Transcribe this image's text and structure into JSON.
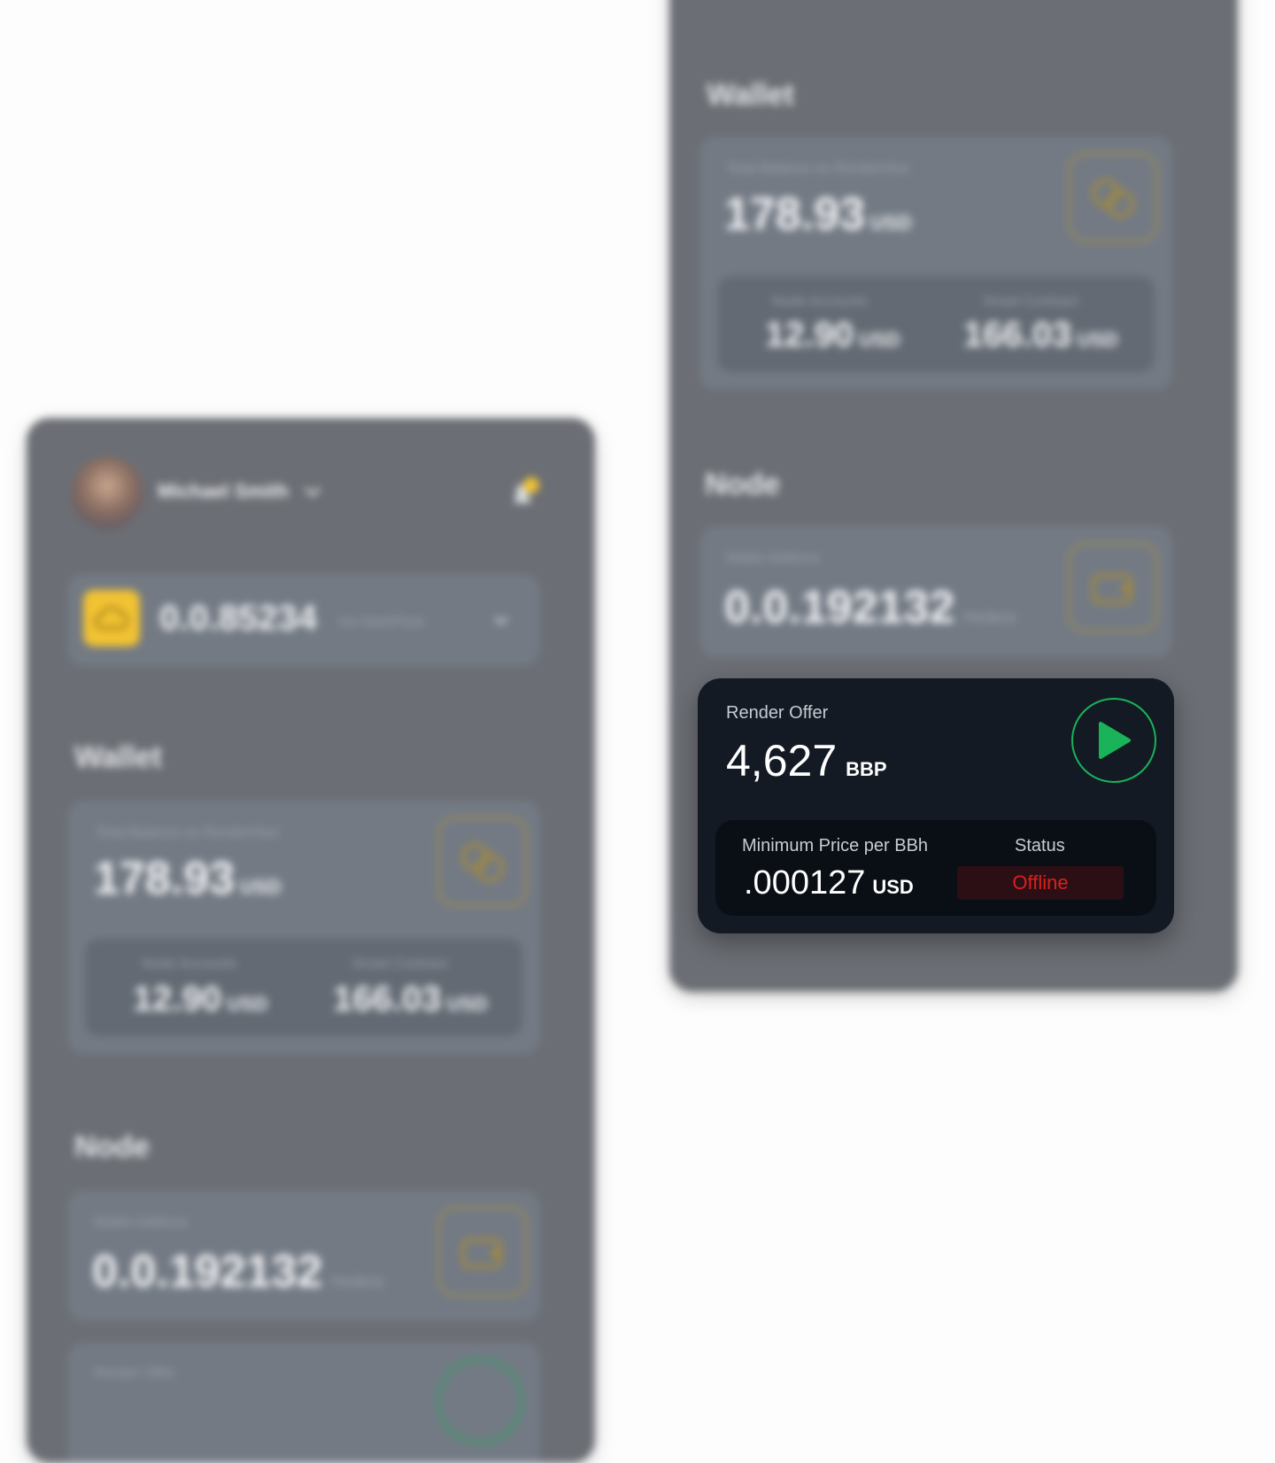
{
  "colors": {
    "accent_gold": "#f1c232",
    "play_green": "#19b35a",
    "offline_red": "#dc1f1f",
    "focus_card_bg": "#131a23",
    "panel_bg": "#6b6e74"
  },
  "left_panel": {
    "user_name": "Michael Smith",
    "balance": {
      "value": "0.0.85234",
      "sub": "via HashPack",
      "icon": "cloud-icon"
    },
    "wallet": {
      "title": "Wallet",
      "total_label": "Total Balance on RenderHive",
      "total_value": "178.93",
      "total_unit": "USD",
      "node_accounts_label": "Node Accounts",
      "node_accounts_value": "12.90",
      "node_accounts_unit": "USD",
      "smart_contract_label": "Smart Contract",
      "smart_contract_value": "166.03",
      "smart_contract_unit": "USD",
      "icon": "coins-icon"
    },
    "node": {
      "title": "Node",
      "wallet_label": "Wallet Address",
      "wallet_value": "0.0.192132",
      "wallet_sub": "Hedera",
      "icon": "wallet-icon",
      "offer_label": "Render Offer"
    }
  },
  "right_panel": {
    "wallet": {
      "title": "Wallet",
      "total_label": "Total Balance on RenderHive",
      "total_value": "178.93",
      "total_unit": "USD",
      "node_accounts_label": "Node Accounts",
      "node_accounts_value": "12.90",
      "node_accounts_unit": "USD",
      "smart_contract_label": "Smart Contract",
      "smart_contract_value": "166.03",
      "smart_contract_unit": "USD"
    },
    "node": {
      "title": "Node",
      "wallet_label": "Wallet Address",
      "wallet_value": "0.0.192132",
      "wallet_sub": "Hedera"
    }
  },
  "render_offer": {
    "label": "Render Offer",
    "value": "4,627",
    "unit": "BBP",
    "min_price_label": "Minimum Price per BBh",
    "min_price_value": ".000127",
    "min_price_unit": "USD",
    "status_label": "Status",
    "status_value": "Offline",
    "play_icon": "play-icon"
  }
}
